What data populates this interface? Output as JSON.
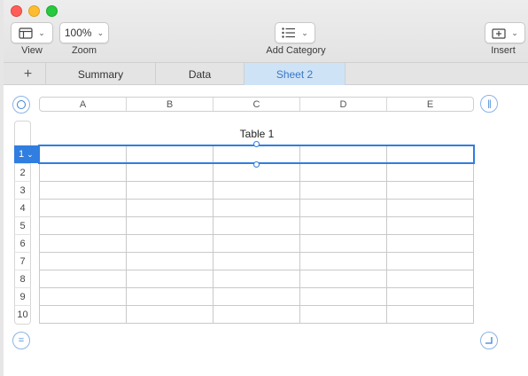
{
  "toolbar": {
    "view_label": "View",
    "zoom_value": "100%",
    "zoom_label": "Zoom",
    "add_category_label": "Add Category",
    "insert_label": "Insert"
  },
  "tabs": [
    {
      "label": "Summary"
    },
    {
      "label": "Data"
    },
    {
      "label": "Sheet 2"
    }
  ],
  "table": {
    "title": "Table 1",
    "columns": [
      "A",
      "B",
      "C",
      "D",
      "E"
    ],
    "rows": [
      "1",
      "2",
      "3",
      "4",
      "5",
      "6",
      "7",
      "8",
      "9",
      "10"
    ],
    "selected_row": "1"
  },
  "colors": {
    "accent": "#2f7ee0",
    "active_tab_bg": "#cfe3f7"
  }
}
